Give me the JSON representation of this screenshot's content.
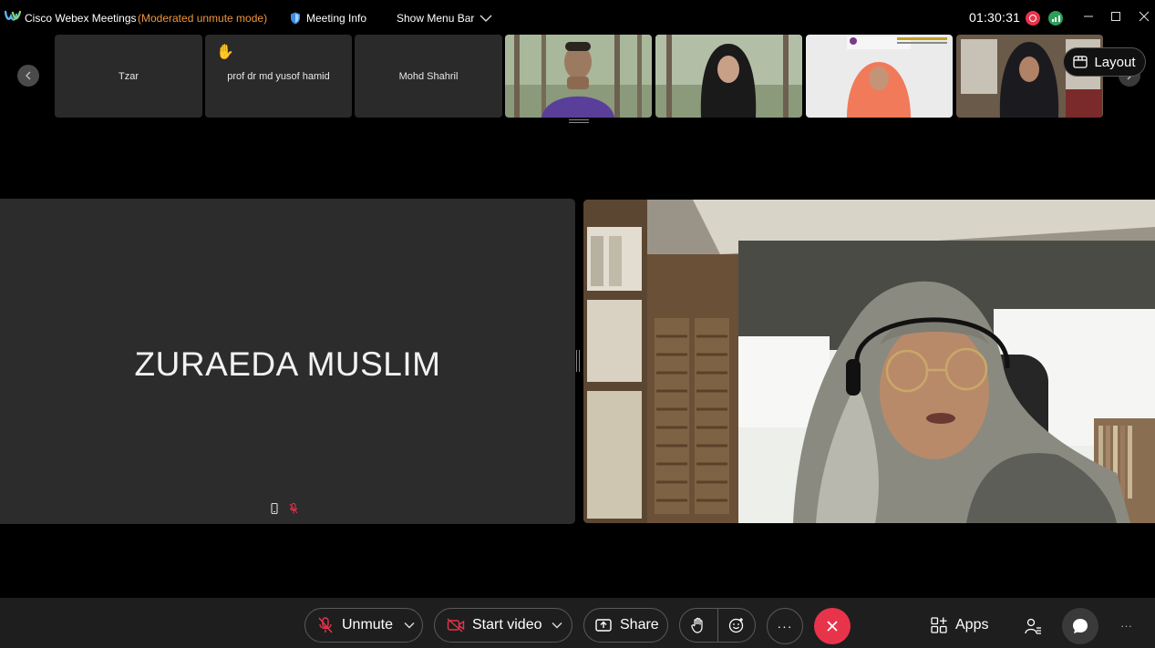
{
  "titlebar": {
    "app_name": "Cisco Webex Meetings",
    "mode": "(Moderated unmute mode)",
    "meeting_info_label": "Meeting Info",
    "show_menu_label": "Show Menu Bar",
    "timer": "01:30:31"
  },
  "filmstrip": {
    "name_tiles": [
      {
        "name": "Tzar",
        "hand_raised": false
      },
      {
        "name": "prof dr md yusof hamid",
        "hand_raised": true
      },
      {
        "name": "Mohd Shahril",
        "hand_raised": false
      }
    ],
    "layout_label": "Layout"
  },
  "stage": {
    "left_participant": "ZURAEDA MUSLIM"
  },
  "controls": {
    "unmute_label": "Unmute",
    "start_video_label": "Start video",
    "share_label": "Share",
    "more_glyph": "···",
    "apps_label": "Apps",
    "overflow_glyph": "···"
  },
  "colors": {
    "mode_text": "#f0953a",
    "end_call": "#e8344b",
    "record": "#e8344b",
    "stats": "#2f9e5b",
    "muted_icon": "#e8344b",
    "tile_bg": "#2a2a2a"
  },
  "icons": [
    "webex-logo-icon",
    "shield-icon",
    "chevron-down-icon",
    "minimize-icon",
    "maximize-icon",
    "close-icon",
    "raise-hand-icon",
    "layout-icon",
    "mic-muted-icon",
    "video-off-icon",
    "share-icon",
    "reaction-icon",
    "apps-icon",
    "participants-icon",
    "chat-icon"
  ]
}
